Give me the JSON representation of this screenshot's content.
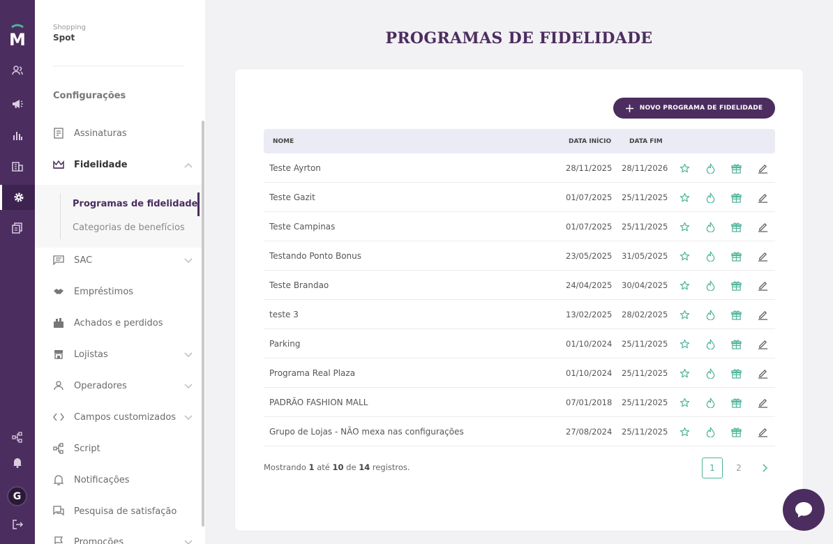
{
  "sidebar": {
    "org_label": "Shopping",
    "org_name": "Spot",
    "section_title": "Configurações",
    "items": [
      {
        "label": "Assinaturas"
      },
      {
        "label": "Fidelidade"
      },
      {
        "label": "SAC"
      },
      {
        "label": "Empréstimos"
      },
      {
        "label": "Achados e perdidos"
      },
      {
        "label": "Lojistas"
      },
      {
        "label": "Operadores"
      },
      {
        "label": "Campos customizados"
      },
      {
        "label": "Script"
      },
      {
        "label": "Notificações"
      },
      {
        "label": "Pesquisa de satisfação"
      },
      {
        "label": "Promoções"
      }
    ],
    "subitems": [
      {
        "label": "Programas de fidelidade"
      },
      {
        "label": "Categorias de benefícios"
      }
    ]
  },
  "user": {
    "initial": "G"
  },
  "page": {
    "title": "PROGRAMAS DE FIDELIDADE",
    "new_button": "NOVO PROGRAMA DE FIDELIDADE"
  },
  "table": {
    "headers": {
      "name": "NOME",
      "start": "DATA INÍCIO",
      "end": "DATA FIM"
    },
    "rows": [
      {
        "name": "Teste Ayrton",
        "start": "28/11/2025",
        "end": "28/11/2026"
      },
      {
        "name": "Teste Gazit",
        "start": "01/07/2025",
        "end": "25/11/2025"
      },
      {
        "name": "Teste Campinas",
        "start": "01/07/2025",
        "end": "25/11/2025"
      },
      {
        "name": "Testando Ponto Bonus",
        "start": "23/05/2025",
        "end": "31/05/2025"
      },
      {
        "name": "Teste Brandao",
        "start": "24/04/2025",
        "end": "30/04/2025"
      },
      {
        "name": "teste 3",
        "start": "13/02/2025",
        "end": "28/02/2025"
      },
      {
        "name": "Parking",
        "start": "01/10/2024",
        "end": "25/11/2025"
      },
      {
        "name": "Programa Real Plaza",
        "start": "01/10/2024",
        "end": "25/11/2025"
      },
      {
        "name": "PADRÃO FASHION MALL",
        "start": "07/01/2018",
        "end": "25/11/2025"
      },
      {
        "name": "Grupo de Lojas - NÃO mexa nas configurações",
        "start": "27/08/2024",
        "end": "25/11/2025"
      }
    ]
  },
  "pagination": {
    "prefix": "Mostrando",
    "from": "1",
    "to_word": "até",
    "to": "10",
    "of_word": "de",
    "total": "14",
    "suffix": "registros.",
    "pages": [
      "1",
      "2"
    ],
    "current": "1"
  },
  "colors": {
    "brand": "#4c2d5f",
    "accent": "#4fb39a"
  },
  "icons": [
    "users-icon",
    "megaphone-icon",
    "chart-icon",
    "building-icon",
    "gear-icon",
    "documents-icon",
    "flow-icon",
    "bell-icon",
    "logout-icon",
    "star-icon",
    "drop-icon",
    "gift-icon",
    "edit-icon",
    "chat-icon"
  ]
}
